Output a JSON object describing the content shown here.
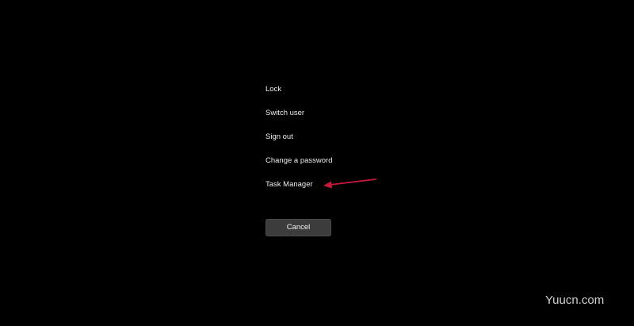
{
  "menu": {
    "items": [
      {
        "label": "Lock"
      },
      {
        "label": "Switch user"
      },
      {
        "label": "Sign out"
      },
      {
        "label": "Change a password"
      },
      {
        "label": "Task Manager"
      }
    ]
  },
  "cancel_button": {
    "label": "Cancel"
  },
  "annotation": {
    "arrow_color": "#c8193c",
    "points_to": "Task Manager"
  },
  "watermark": {
    "text": "Yuucn.com"
  },
  "colors": {
    "background": "#000000",
    "text": "#ededed",
    "button_bg": "#3c3c3c"
  }
}
